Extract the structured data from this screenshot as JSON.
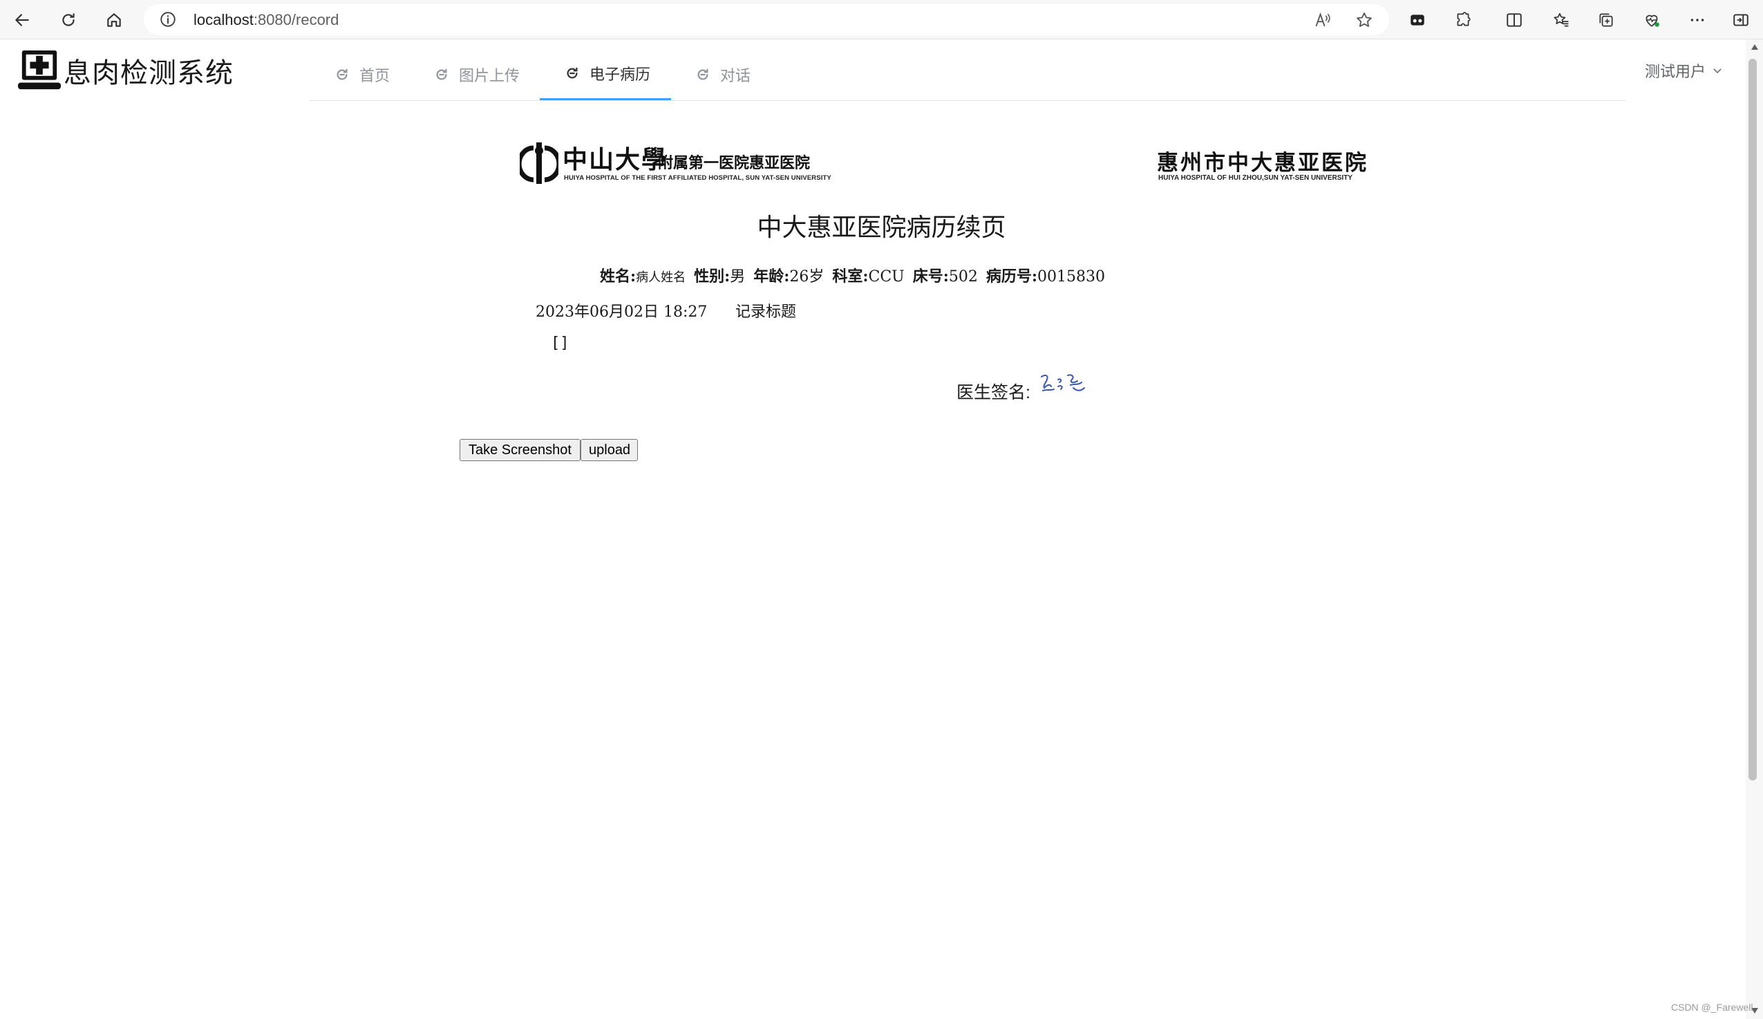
{
  "browser": {
    "url_host": "localhost",
    "url_path": ":8080/record"
  },
  "app": {
    "title": "息肉检测系统"
  },
  "nav": {
    "items": [
      {
        "label": "首页",
        "active": false
      },
      {
        "label": "图片上传",
        "active": false
      },
      {
        "label": "电子病历",
        "active": true
      },
      {
        "label": "对话",
        "active": false
      }
    ],
    "accent_color": "#409eff"
  },
  "user": {
    "name": "测试用户"
  },
  "hospital": {
    "left_logo": {
      "name_big": "中山大學",
      "name_small": "附属第一医院惠亚医院",
      "name_en": "HUIYA HOSPITAL OF THE FIRST AFFILIATED HOSPITAL, SUN YAT-SEN UNIVERSITY"
    },
    "right_logo": {
      "name": "惠州市中大惠亚医院",
      "name_en": "HUIYA HOSPITAL OF HUI ZHOU,SUN YAT-SEN UNIVERSITY"
    }
  },
  "record": {
    "title": "中大惠亚医院病历续页",
    "patient": {
      "name_label": "姓名:",
      "name_value": "病人姓名",
      "gender_label": "性别:",
      "gender_value": "男",
      "age_label": "年龄:",
      "age_value": "26岁",
      "dept_label": "科室:",
      "dept_value": "CCU",
      "bed_label": "床号:",
      "bed_value": "502",
      "record_no_label": "病历号:",
      "record_no_value": "0015830"
    },
    "date": "2023年06月02日 18:27",
    "heading": "记录标题",
    "content": "[]",
    "signature_label": "医生签名:"
  },
  "buttons": {
    "screenshot": "Take Screenshot",
    "upload": "upload"
  },
  "watermark": "CSDN @_Farewell"
}
